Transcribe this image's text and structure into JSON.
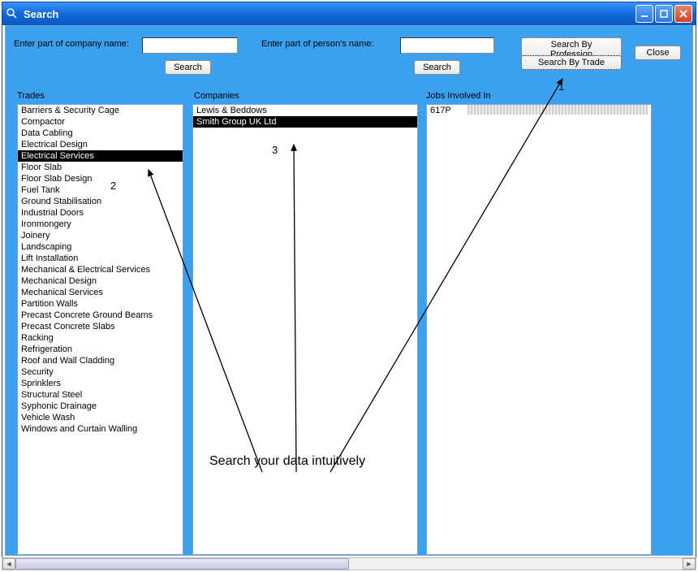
{
  "window": {
    "title": "Search"
  },
  "searchRow": {
    "companyLabel": "Enter part of company name:",
    "personLabel": "Enter part of person's name:",
    "companyInput": "",
    "personInput": "",
    "searchCompanyBtn": "Search",
    "searchPersonBtn": "Search",
    "searchByProfessionBtn": "Search By Profession",
    "searchByTradeBtn": "Search By Trade",
    "closeBtn": "Close"
  },
  "columns": {
    "trades": "Trades",
    "companies": "Companies",
    "jobs": "Jobs Involved In"
  },
  "trades": [
    "Barriers & Security Cage",
    "Compactor",
    "Data Cabling",
    "Electrical Design",
    "Electrical Services",
    "Floor Slab",
    "Floor Slab Design",
    "Fuel Tank",
    "Ground Stabilisation",
    "Industrial Doors",
    "Ironmongery",
    "Joinery",
    "Landscaping",
    "Lift Installation",
    "Mechanical & Electrical Services",
    "Mechanical Design",
    "Mechanical Services",
    "Partition Walls",
    "Precast Concrete Ground Beams",
    "Precast Concrete Slabs",
    "Racking",
    "Refrigeration",
    "Roof and Wall Cladding",
    "Security",
    "Sprinklers",
    "Structural Steel",
    "Syphonic Drainage",
    "Vehicle Wash",
    "Windows and Curtain Walling"
  ],
  "tradesSelectedIndex": 4,
  "companies": [
    "Lewis & Beddows",
    "Smith Group UK Ltd"
  ],
  "companiesSelectedIndex": 1,
  "jobs": [
    {
      "num": "617P",
      "desc": ""
    }
  ],
  "annotations": {
    "caption": "Search your data intuitively",
    "num1": "1",
    "num2": "2",
    "num3": "3"
  }
}
